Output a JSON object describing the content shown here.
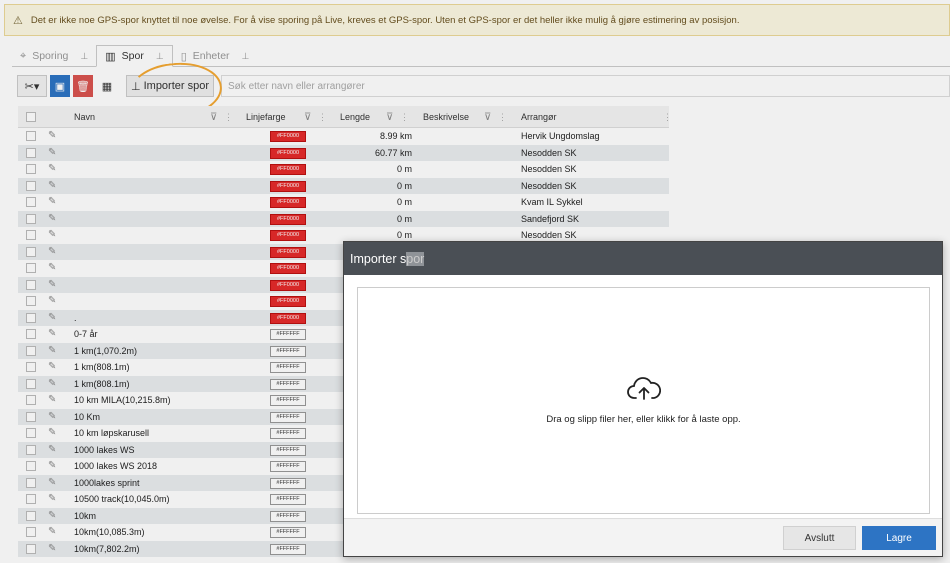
{
  "warning": {
    "icon": "warning-triangle-icon",
    "text": "Det er ikke noe GPS-spor knyttet til noe øvelse. For å vise sporing på Live, kreves et GPS-spor. Uten et GPS-spor er det heller ikke mulig å gjøre estimering av posisjon."
  },
  "tabs": [
    {
      "label": "Sporing",
      "icon": "map-pin-icon",
      "active": false
    },
    {
      "label": "Spor",
      "icon": "map-icon",
      "active": true
    },
    {
      "label": "Enheter",
      "icon": "devices-icon",
      "active": false
    }
  ],
  "toolbar": {
    "import_label": "Importer spor",
    "search_placeholder": "Søk etter navn eller arrangører"
  },
  "grid": {
    "columns": [
      "Navn",
      "Linjefarge",
      "Lengde",
      "Beskrivelse",
      "Arrangør"
    ],
    "rows": [
      {
        "name": "",
        "color": "#FF0000",
        "length": "8.99 km",
        "org": "Hervik Ungdomslag"
      },
      {
        "name": "",
        "color": "#FF0000",
        "length": "60.77 km",
        "org": "Nesodden SK"
      },
      {
        "name": "",
        "color": "#FF0000",
        "length": "0 m",
        "org": "Nesodden SK"
      },
      {
        "name": "",
        "color": "#FF0000",
        "length": "0 m",
        "org": "Nesodden SK"
      },
      {
        "name": "",
        "color": "#FF0000",
        "length": "0 m",
        "org": "Kvam IL Sykkel"
      },
      {
        "name": "",
        "color": "#FF0000",
        "length": "0 m",
        "org": "Sandefjord SK"
      },
      {
        "name": "",
        "color": "#FF0000",
        "length": "0 m",
        "org": "Nesodden SK"
      },
      {
        "name": "",
        "color": "#FF0000",
        "length": "",
        "org": ""
      },
      {
        "name": "",
        "color": "#FF0000",
        "length": "",
        "org": ""
      },
      {
        "name": "",
        "color": "#FF0000",
        "length": "",
        "org": ""
      },
      {
        "name": "",
        "color": "#FF0000",
        "length": "",
        "org": ""
      },
      {
        "name": ".",
        "color": "#FF0000",
        "length": "",
        "org": ""
      },
      {
        "name": "0-7 år",
        "color": "#FFFFFF",
        "length": "",
        "org": ""
      },
      {
        "name": "1 km(1,070.2m)",
        "color": "#FFFFFF",
        "length": "",
        "org": ""
      },
      {
        "name": "1 km(808.1m)",
        "color": "#FFFFFF",
        "length": "",
        "org": ""
      },
      {
        "name": "1 km(808.1m)",
        "color": "#FFFFFF",
        "length": "",
        "org": ""
      },
      {
        "name": "10 km MILA(10,215.8m)",
        "color": "#FFFFFF",
        "length": "",
        "org": ""
      },
      {
        "name": "10 Km",
        "color": "#FFFFFF",
        "length": "",
        "org": ""
      },
      {
        "name": "10 km løpskarusell",
        "color": "#FFFFFF",
        "length": "",
        "org": ""
      },
      {
        "name": "1000 lakes WS",
        "color": "#FFFFFF",
        "length": "",
        "org": ""
      },
      {
        "name": "1000 lakes WS 2018",
        "color": "#FFFFFF",
        "length": "",
        "org": ""
      },
      {
        "name": "1000lakes sprint",
        "color": "#FFFFFF",
        "length": "",
        "org": ""
      },
      {
        "name": "10500 track(10,045.0m)",
        "color": "#FFFFFF",
        "length": "",
        "org": ""
      },
      {
        "name": "10km",
        "color": "#FFFFFF",
        "length": "",
        "org": ""
      },
      {
        "name": "10km(10,085.3m)",
        "color": "#FFFFFF",
        "length": "",
        "org": ""
      },
      {
        "name": "10km(7,802.2m)",
        "color": "#FFFFFF",
        "length": "",
        "org": ""
      }
    ]
  },
  "dialog": {
    "title_a": "Importer s",
    "title_b": "por",
    "dropzone_text": "Dra og slipp filer her, eller klikk for å laste opp.",
    "cancel_label": "Avslutt",
    "save_label": "Lagre"
  },
  "colors": {
    "accent": "#2d74c4",
    "danger": "#d9534f",
    "track_red": "#e52b2b"
  }
}
